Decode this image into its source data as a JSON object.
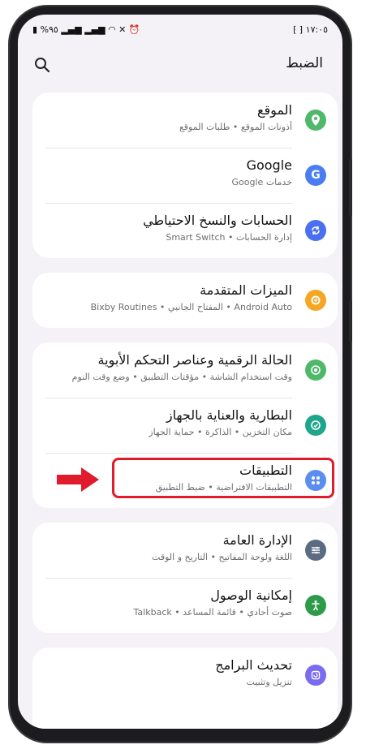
{
  "status_bar": {
    "time": "١٧:٠٥",
    "battery": "%٩٥"
  },
  "header": {
    "title": "الضبط"
  },
  "groups": [
    {
      "items": [
        {
          "title": "الموقع",
          "subtitle": "أذونات الموقع • طلبات الموقع",
          "icon": "location-pin-icon",
          "color": "#4fb86a"
        },
        {
          "title": "Google",
          "subtitle": "خدمات Google",
          "icon": "google-icon",
          "color": "#4a7ef0"
        },
        {
          "title": "الحسابات والنسخ الاحتياطي",
          "subtitle": "إدارة الحسابات • Smart Switch",
          "icon": "sync-icon",
          "color": "#4a6ff0"
        }
      ]
    },
    {
      "items": [
        {
          "title": "الميزات المتقدمة",
          "subtitle": "Android Auto • المفتاح الجانبي • Bixby Routines",
          "icon": "gear-plus-icon",
          "color": "#f5a623"
        }
      ]
    },
    {
      "items": [
        {
          "title": "الحالة الرقمية وعناصر التحكم الأبوية",
          "subtitle": "وقت استخدام الشاشة • مؤقتات التطبيق • وضع وقت النوم",
          "icon": "digital-wellbeing-icon",
          "color": "#4fb86a"
        },
        {
          "title": "البطارية والعناية بالجهاز",
          "subtitle": "مكان التخزين • الذاكرة • حماية الجهاز",
          "icon": "device-care-icon",
          "color": "#1fa58b"
        },
        {
          "title": "التطبيقات",
          "subtitle": "التطبيقات الافتراضية • ضبط التطبيق",
          "icon": "apps-grid-icon",
          "color": "#5b8ef0"
        }
      ]
    },
    {
      "items": [
        {
          "title": "الإدارة العامة",
          "subtitle": "اللغة ولوحة المفاتيح • التاريخ و الوقت",
          "icon": "sliders-icon",
          "color": "#5a6b82"
        },
        {
          "title": "إمكانية الوصول",
          "subtitle": "صوت أحادي • قائمة المساعد • Talkback",
          "icon": "accessibility-icon",
          "color": "#2e9b4a"
        }
      ]
    },
    {
      "items": [
        {
          "title": "تحديث البرامج",
          "subtitle": "تنزيل وتثبيت",
          "icon": "software-update-icon",
          "color": "#7a6cf0"
        }
      ]
    }
  ],
  "colors": {
    "highlight": "#e01b2b",
    "arrow": "#e01b2b"
  }
}
